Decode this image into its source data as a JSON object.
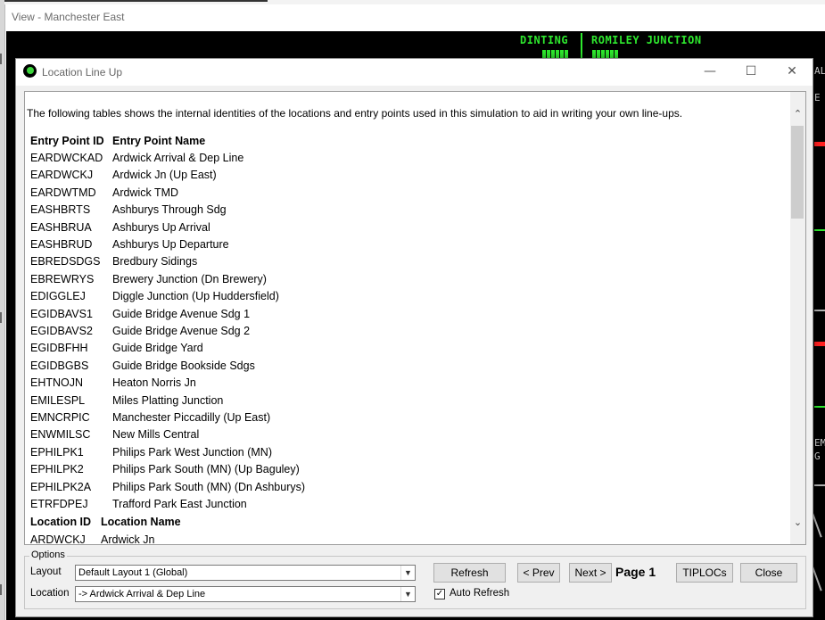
{
  "background_window": {
    "title": "View - Manchester East",
    "labels": [
      "DINTING",
      "ROMILEY JUNCTION",
      "AL",
      "E",
      "EM",
      "G"
    ]
  },
  "dialog": {
    "title": "Location Line Up",
    "controls": {
      "minimize": "—",
      "maximize": "☐",
      "close": "✕"
    },
    "intro": "The following tables shows the internal identities of the locations and entry points used in this simulation to aid in writing your own line-ups.",
    "entry_table": {
      "headers": [
        "Entry Point ID",
        "Entry Point Name"
      ],
      "rows": [
        [
          "EARDWCKAD",
          "Ardwick Arrival & Dep Line"
        ],
        [
          "EARDWCKJ",
          "Ardwick Jn (Up East)"
        ],
        [
          "EARDWTMD",
          "Ardwick TMD"
        ],
        [
          "EASHBRTS",
          "Ashburys Through Sdg"
        ],
        [
          "EASHBRUA",
          "Ashburys Up Arrival"
        ],
        [
          "EASHBRUD",
          "Ashburys Up Departure"
        ],
        [
          "EBREDSDGS",
          "Bredbury Sidings"
        ],
        [
          "EBREWRYS",
          "Brewery Junction (Dn Brewery)"
        ],
        [
          "EDIGGLEJ",
          "Diggle Junction (Up Huddersfield)"
        ],
        [
          "EGIDBAVS1",
          "Guide Bridge Avenue Sdg 1"
        ],
        [
          "EGIDBAVS2",
          "Guide Bridge Avenue Sdg 2"
        ],
        [
          "EGIDBFHH",
          "Guide Bridge Yard"
        ],
        [
          "EGIDBGBS",
          "Guide Bridge Bookside Sdgs"
        ],
        [
          "EHTNOJN",
          "Heaton Norris Jn"
        ],
        [
          "EMILESPL",
          "Miles Platting Junction"
        ],
        [
          "EMNCRPIC",
          "Manchester Piccadilly (Up East)"
        ],
        [
          "ENWMILSC",
          "New Mills Central"
        ],
        [
          "EPHILPK1",
          "Philips Park West Junction (MN)"
        ],
        [
          "EPHILPK2",
          "Philips Park South (MN) (Up Baguley)"
        ],
        [
          "EPHILPK2A",
          "Philips Park South (MN) (Dn Ashburys)"
        ],
        [
          "ETRFDPEJ",
          "Trafford Park East Junction"
        ]
      ]
    },
    "location_table": {
      "headers": [
        "Location ID",
        "Location Name"
      ],
      "rows": [
        [
          "ARDWCKJ",
          "Ardwick Jn"
        ]
      ]
    },
    "scroll": {
      "up": "⌃",
      "down": "⌄"
    },
    "options": {
      "legend": "Options",
      "layout_label": "Layout",
      "layout_value": "Default Layout 1 (Global)",
      "location_label": "Location",
      "location_value": "-> Ardwick Arrival & Dep Line",
      "dropdown_glyph": "▼",
      "refresh": "Refresh",
      "auto_refresh": "Auto Refresh",
      "auto_refresh_checked": "✓",
      "prev": "< Prev",
      "next": "Next >",
      "page": "Page 1",
      "tiplocs": "TIPLOCs",
      "close": "Close"
    }
  }
}
